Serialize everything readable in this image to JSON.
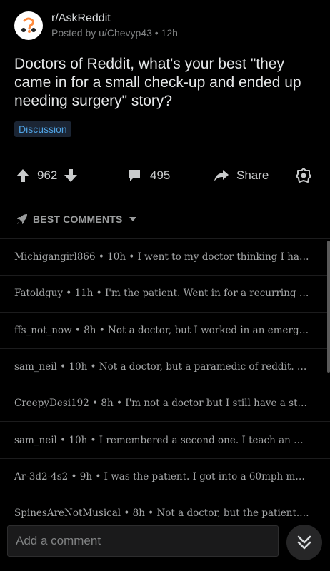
{
  "post": {
    "subreddit": "r/AskReddit",
    "posted_by": "Posted by u/Chevyp43 • 12h",
    "title": "Doctors of Reddit, what's your best \"they came in for a small check-up and ended up needing surgery\" story?",
    "flair": "Discussion",
    "flair_color": "#4fa3e4",
    "avatar_icon": "askreddit-question-icon"
  },
  "actions": {
    "score": "962",
    "comments_count": "495",
    "share_label": "Share",
    "upvote_icon": "upvote-arrow-icon",
    "downvote_icon": "downvote-arrow-icon",
    "comment_icon": "comment-bubble-icon",
    "share_icon": "share-arrow-icon",
    "award_icon": "award-icon"
  },
  "sort": {
    "label": "BEST COMMENTS",
    "icon": "rocket-icon"
  },
  "comments": [
    {
      "preview": "Michigangirl866 • 10h • I went to my doctor thinking I had …"
    },
    {
      "preview": "Fatoldguy • 11h • I'm the patient.  Went in for a recurring p…"
    },
    {
      "preview": "ffs_not_now • 8h • Not a doctor, but I worked in an emerge…"
    },
    {
      "preview": "sam_neil • 10h • Not a doctor, but a paramedic of reddit.  …"
    },
    {
      "preview": "CreepyDesi192 • 8h • I'm not a doctor but I still have a sto…"
    },
    {
      "preview": "sam_neil • 10h • I remembered a second one.   I teach an …"
    },
    {
      "preview": "Ar-3d2-4s2 • 9h • I was the patient.  I got into a 60mph m…"
    },
    {
      "preview": "SpinesAreNotMusical • 8h • Not a doctor, but the patient.W…"
    }
  ],
  "composer": {
    "placeholder": "Add a comment",
    "jump_icon": "double-chevron-down-icon"
  }
}
